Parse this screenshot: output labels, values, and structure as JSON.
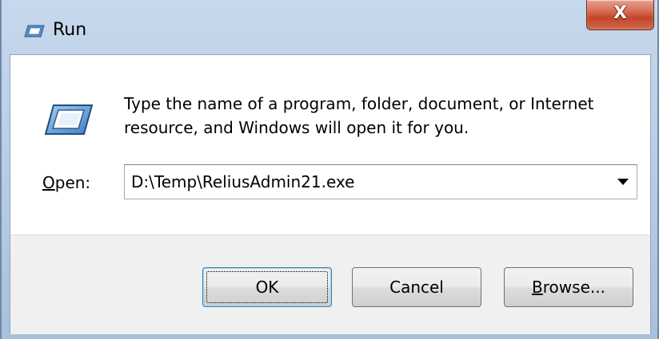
{
  "window": {
    "title": "Run",
    "close_glyph": "X",
    "icon": "run-icon"
  },
  "main": {
    "description": "Type the name of a program, folder, document, or Internet resource, and Windows will open it for you.",
    "open_label_accel": "O",
    "open_label_rest": "pen:",
    "open_value": "D:\\Temp\\ReliusAdmin21.exe"
  },
  "buttons": {
    "ok": "OK",
    "cancel": "Cancel",
    "browse_accel": "B",
    "browse_rest": "rowse..."
  },
  "colors": {
    "close_button": "#c2452b",
    "default_button_border": "#3c7fb1"
  }
}
